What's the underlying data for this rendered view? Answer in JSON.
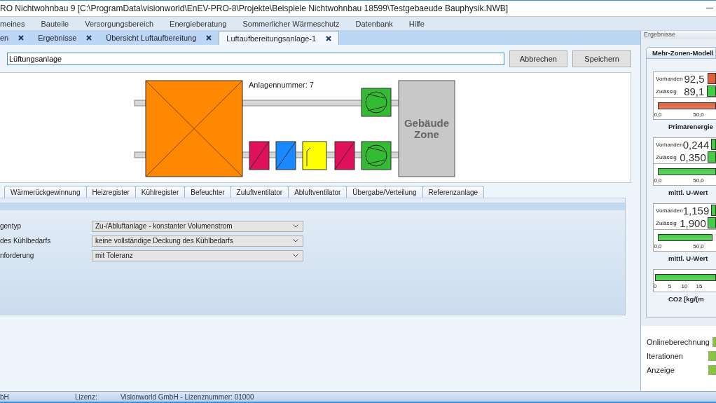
{
  "window": {
    "title": "RO Nichtwohnbau 9 [C:\\ProgramData\\visionworld\\EnEV-PRO-8\\Projekte\\Beispiele Nichtwohnbau 18599\\Testgebaeude Bauphysik.NWB]"
  },
  "menu": [
    "meines",
    "Bauteile",
    "Versorgungsbereich",
    "Energieberatung",
    "Sommerlicher Wärmeschutz",
    "Datenbank",
    "Hilfe"
  ],
  "doc_tabs": [
    {
      "label": "en",
      "selected": false
    },
    {
      "label": "Ergebnisse",
      "selected": false
    },
    {
      "label": "Übersicht Luftaufbereitung",
      "selected": false
    },
    {
      "label": "Luftaufbereitungsanlage-1",
      "selected": true
    }
  ],
  "name_field": {
    "value": "Lüftungsanlage"
  },
  "buttons": [
    "Abbrechen",
    "Speichern"
  ],
  "diagram": {
    "plant_number": "Anlagennummer: 7",
    "zone_label": "Gebäude Zone"
  },
  "component_tabs": [
    {
      "label": "Wärmerückgewinnung",
      "selected": false
    },
    {
      "label": "Heizregister",
      "selected": false
    },
    {
      "label": "Kühlregister",
      "selected": false
    },
    {
      "label": "Befeuchter",
      "selected": false
    },
    {
      "label": "Zuluftventilator",
      "selected": false
    },
    {
      "label": "Abluftventilator",
      "selected": false
    },
    {
      "label": "Übergabe/Verteilung",
      "selected": false
    },
    {
      "label": "Referenzanlage",
      "selected": false
    }
  ],
  "settings": [
    {
      "label": "gentyp",
      "value": "Zu-/Abluftanlage - konstanter Volumenstrom"
    },
    {
      "label": "des Kühlbedarfs",
      "value": "keine vollständige Deckung des Kühlbedarfs"
    },
    {
      "label": "nforderung",
      "value": "mit Toleranz"
    }
  ],
  "results": {
    "header": "Ergebnisse",
    "card_title": "Mehr-Zonen-Modell",
    "groups": [
      {
        "kind": "comparison",
        "rows": [
          {
            "label": "Vorhanden",
            "value": "92,5",
            "color": "#e0603a"
          },
          {
            "label": "Zulässig",
            "value": "89,1",
            "color": "#44cc44"
          }
        ],
        "bar": {
          "level": 1,
          "color": "#e0603a",
          "ticks": [
            "0,0",
            "50,0"
          ]
        },
        "caption": "Primärenergie"
      },
      {
        "kind": "comparison",
        "rows": [
          {
            "label": "Vorhanden",
            "value": "0,244",
            "color": "#44cc44"
          },
          {
            "label": "Zulässig",
            "value": "0,350",
            "color": "#44cc44"
          }
        ],
        "bar": {
          "level": 1,
          "color": "#44cc44",
          "ticks": [
            "0,0",
            "50,0"
          ]
        },
        "caption": "mittl. U-Wert"
      },
      {
        "kind": "comparison",
        "rows": [
          {
            "label": "Vorhanden",
            "value": "1,159",
            "color": "#44cc44"
          },
          {
            "label": "Zulässig",
            "value": "1,900",
            "color": "#44cc44"
          }
        ],
        "bar": {
          "level": 0.94,
          "color": "#44cc44",
          "ticks": [
            "0,0",
            "50,0"
          ]
        },
        "caption": "mittl. U-Wert"
      },
      {
        "kind": "scale",
        "bar": {
          "level": 1,
          "color": "#44cc44",
          "ticks": [
            "0",
            "5",
            "10",
            "15"
          ]
        },
        "caption": "CO2 [kg/(m"
      }
    ]
  },
  "options": [
    {
      "label": "Onlineberechnung",
      "on": true
    },
    {
      "label": "Iterationen",
      "on": true
    },
    {
      "label": "Anzeige",
      "on": true
    }
  ],
  "status_bar": [
    "bH",
    "Lizenz:",
    "Visionworld GmbH - Lizenznummer: 01000"
  ]
}
